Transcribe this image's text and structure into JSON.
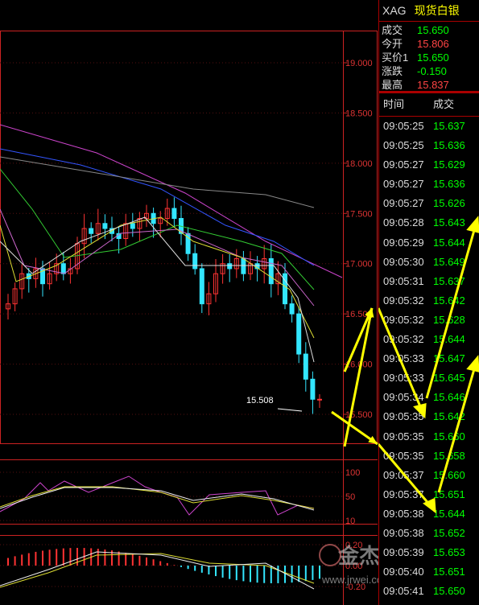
{
  "header": {
    "symbol": "XAG",
    "name": "现货白银"
  },
  "quote": [
    {
      "label": "成交",
      "value": "15.650",
      "color": "green"
    },
    {
      "label": "今开",
      "value": "15.806",
      "color": "red"
    },
    {
      "label": "买价1",
      "value": "15.650",
      "color": "green"
    },
    {
      "label": "涨跌",
      "value": "-0.150",
      "color": "green"
    },
    {
      "label": "最高",
      "value": "15.837",
      "color": "red"
    }
  ],
  "ticks_header": {
    "time": "时间",
    "price": "成交"
  },
  "ticks": [
    {
      "time": "09:05:25",
      "price": "15.637"
    },
    {
      "time": "09:05:25",
      "price": "15.636"
    },
    {
      "time": "09:05:27",
      "price": "15.629"
    },
    {
      "time": "09:05:27",
      "price": "15.636"
    },
    {
      "time": "09:05:27",
      "price": "15.626"
    },
    {
      "time": "09:05:28",
      "price": "15.643"
    },
    {
      "time": "09:05:29",
      "price": "15.644"
    },
    {
      "time": "09:05:30",
      "price": "15.649"
    },
    {
      "time": "09:05:31",
      "price": "15.637"
    },
    {
      "time": "09:05:32",
      "price": "15.642"
    },
    {
      "time": "09:05:32",
      "price": "15.628"
    },
    {
      "time": "09:05:32",
      "price": "15.644"
    },
    {
      "time": "09:05:33",
      "price": "15.647"
    },
    {
      "time": "09:05:33",
      "price": "15.645"
    },
    {
      "time": "09:05:34",
      "price": "15.646"
    },
    {
      "time": "09:05:35",
      "price": "15.642"
    },
    {
      "time": "09:05:35",
      "price": "15.660"
    },
    {
      "time": "09:05:35",
      "price": "15.658"
    },
    {
      "time": "09:05:37",
      "price": "15.660"
    },
    {
      "time": "09:05:37",
      "price": "15.651"
    },
    {
      "time": "09:05:38",
      "price": "15.644"
    },
    {
      "time": "09:05:38",
      "price": "15.652"
    },
    {
      "time": "09:05:39",
      "price": "15.653"
    },
    {
      "time": "09:05:40",
      "price": "15.651"
    },
    {
      "time": "09:05:41",
      "price": "15.650"
    }
  ],
  "main_axis": [
    "19.000",
    "18.500",
    "18.000",
    "17.500",
    "17.000",
    "16.500",
    "16.000",
    "15.500"
  ],
  "low_label": "15.508",
  "kdj_axis": [
    "100",
    "50",
    "10"
  ],
  "macd_axis": [
    "0.20",
    "0.00",
    "-0.20"
  ],
  "watermark": {
    "brand": "金杰网",
    "url": "www.jrwei.com"
  },
  "colors": {
    "up": "#ff3333",
    "down": "#33e6ff",
    "axis": "#cc2222",
    "arrow": "#ffff00"
  }
}
